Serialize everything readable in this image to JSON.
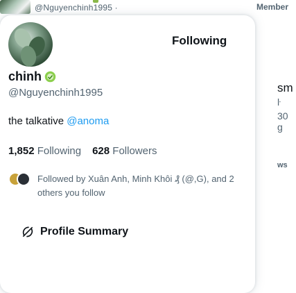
{
  "background": {
    "handle_top": "@Ngu",
    "handle": "@Nguyenchinh1995 ·",
    "member_label": "Member",
    "right_fragments": [
      "sm",
      "ŀ",
      "30 g",
      "ws"
    ]
  },
  "card": {
    "follow_button": "Following",
    "display_name": "chinh",
    "handle": "@Nguyenchinh1995",
    "bio_text": "the talkative ",
    "bio_mention": "@anoma",
    "following_count": "1,852",
    "following_label": "Following",
    "followers_count": "628",
    "followers_label": "Followers",
    "followed_by": "Followed by Xuân Anh, Minh Khôi ₰ (@,G), and 2 others you follow",
    "summary_button": "Profile Summary"
  },
  "icons": {
    "verified": "verified-badge-icon",
    "summary": "grok-icon"
  },
  "colors": {
    "accent": "#1d9bf0",
    "secondary_text": "#536471",
    "primary_text": "#0f1419"
  }
}
